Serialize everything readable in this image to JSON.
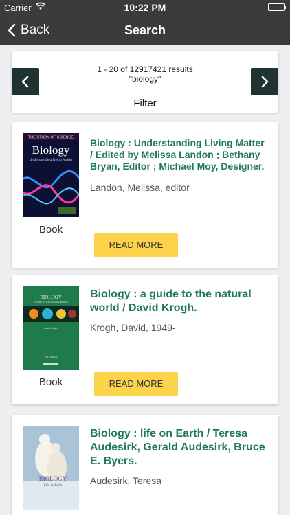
{
  "status": {
    "carrier": "Carrier",
    "time": "10:22 PM"
  },
  "nav": {
    "back_label": "Back",
    "title": "Search"
  },
  "pager": {
    "count_text": "1 - 20 of 12917421 results",
    "query_text": "\"biology\"",
    "filter_label": "Filter"
  },
  "results": [
    {
      "title": "Biology : Understanding Living Matter / Edited by Melissa Landon ; Bethany Bryan, Editor ; Michael Moy, Designer.",
      "author": "Landon, Melissa, editor",
      "type": "Book",
      "cover_series": "THE STUDY OF SCIENCE",
      "cover_title": "Biology",
      "cover_subtitle": "Understanding Living Matter",
      "read_more": "READ MORE"
    },
    {
      "title": "Biology : a guide to the natural world / David Krogh.",
      "author": "Krogh, David, 1949-",
      "type": "Book",
      "cover_title": "BIOLOGY",
      "cover_subtitle": "A GUIDE TO THE NATURAL WORLD",
      "cover_author": "David Krogh",
      "cover_edition": "Third Edition",
      "read_more": "READ MORE"
    },
    {
      "title": "Biology : life on Earth / Teresa Audesirk, Gerald Audesirk, Bruce E. Byers.",
      "author": "Audesirk, Teresa",
      "cover_title": "BIOLOGY",
      "cover_subtitle": "Life on Earth"
    }
  ],
  "colors": {
    "nav_bg": "#3b3b3b",
    "pager_arrow": "#1f3332",
    "title_green": "#1f7a58",
    "button_yellow": "#fcd34a"
  }
}
